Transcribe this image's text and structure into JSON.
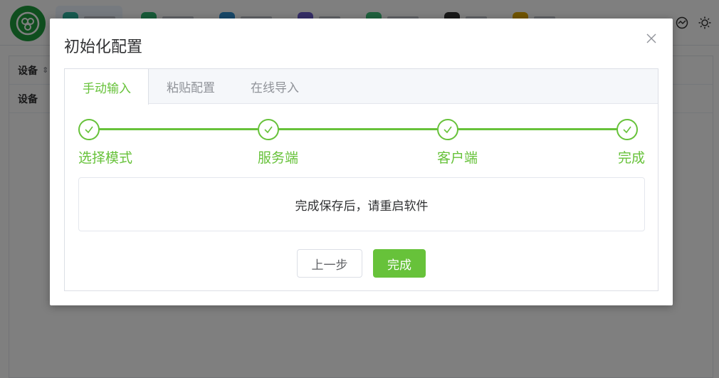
{
  "background": {
    "table_header": "设备",
    "table_row": "设备"
  },
  "dialog": {
    "title": "初始化配置",
    "tabs": [
      {
        "label": "手动输入",
        "active": true
      },
      {
        "label": "粘贴配置",
        "active": false
      },
      {
        "label": "在线导入",
        "active": false
      }
    ],
    "steps": [
      {
        "label": "选择模式",
        "status": "success"
      },
      {
        "label": "服务端",
        "status": "success"
      },
      {
        "label": "客户端",
        "status": "success"
      },
      {
        "label": "完成",
        "status": "success"
      }
    ],
    "message": "完成保存后，请重启软件",
    "prev_button": "上一步",
    "done_button": "完成"
  },
  "colors": {
    "accent": "#67c23a",
    "logo": "#1f9d3c",
    "overlay": "rgba(0,0,0,0.5)"
  }
}
